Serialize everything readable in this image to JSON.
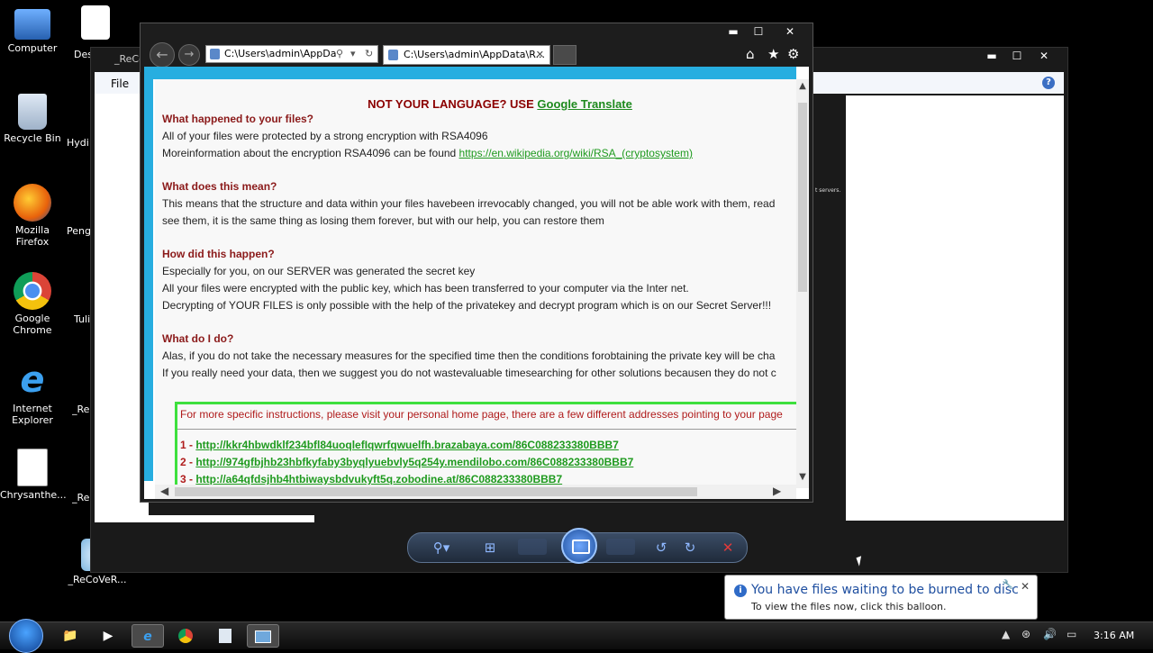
{
  "desktop": {
    "icons": [
      {
        "label": "Computer"
      },
      {
        "label": "Recycle Bin"
      },
      {
        "label": "Mozilla Firefox"
      },
      {
        "label": "Google Chrome"
      },
      {
        "label": "Internet Explorer"
      },
      {
        "label": "Chrysanthe..."
      }
    ],
    "partial_icons": [
      {
        "label": "Des"
      },
      {
        "label": "Hydi"
      },
      {
        "label": "Peng"
      },
      {
        "label": "Tuli"
      },
      {
        "label": "_ReC"
      },
      {
        "label": "_Re"
      },
      {
        "label": "_ReCoVeR..."
      }
    ]
  },
  "back_window": {
    "title": "_ReCo",
    "menu_file": "File",
    "help": "?",
    "tiny_text": "t servers."
  },
  "browser": {
    "address_text": "C:\\Users\\admin\\AppDa",
    "tab_label": "C:\\Users\\admin\\AppData\\R...",
    "tab_close": "✕",
    "controls": {
      "minimize": "▬",
      "maximize": "☐",
      "close": "✕"
    },
    "toolbar_icons": {
      "home": "⌂",
      "favorites": "★",
      "settings": "⚙"
    }
  },
  "note": {
    "lang_prefix": "NOT YOUR LANGUAGE? USE ",
    "lang_link": "Google Translate",
    "h1": "What happened to your files?",
    "p1a": "All of your files were protected by a strong encryption with RSA4096",
    "p1b_text": "Moreinformation about the encryption RSA4096 can be found ",
    "p1b_link": "https://en.wikipedia.org/wiki/RSA_(cryptosystem)",
    "h2": "What does this mean?",
    "p2a": "This means that the structure and data within your files havebeen irrevocably changed, you will not be able work with them, read",
    "p2b": "see them, it is the same thing as losing them forever, but with our help, you can restore them",
    "h3": "How did this happen?",
    "p3a": "Especially for you, on our SERVER was generated the secret key",
    "p3b": "All your files were encrypted with the public key, which has been transferred to your computer via the Inter net.",
    "p3c": "Decrypting of YOUR FILES is only possible with the help of the privatekey and decrypt program which is on our Secret Server!!!",
    "h4": "What do I do?",
    "p4a": "Alas, if you do not take the necessary measures for the specified time then the conditions forobtaining the private key will be cha",
    "p4b": "If you really need your data, then we suggest you do not wastevaluable timesearching for other solutions becausen they do not c",
    "instructions": "For more specific instructions, please visit your personal home page, there are a few different addresses pointing to your page",
    "links": [
      {
        "num": "1 - ",
        "url": "http://kkr4hbwdklf234bfl84uoqlefIqwrfqwuelfh.brazabaya.com/86C088233380BBB7"
      },
      {
        "num": "2 - ",
        "url": "http://974gfbjhb23hbfkyfaby3byqlyuebvly5q254y.mendilobo.com/86C088233380BBB7"
      },
      {
        "num": "3 - ",
        "url": "http://a64qfdsjhb4htbiwaysbdvukyft5q.zobodine.at/86C088233380BBB7"
      }
    ]
  },
  "balloon": {
    "title": "You have files waiting to be burned to disc",
    "body": "To view the files now, click this balloon.",
    "close": "✕"
  },
  "taskbar": {
    "clock": "3:16 AM"
  },
  "colors": {
    "accent_cyan": "#27aee0",
    "link_green": "#1e9a1e",
    "heading_red": "#8b1a1a",
    "box_green": "#3ee03e"
  }
}
